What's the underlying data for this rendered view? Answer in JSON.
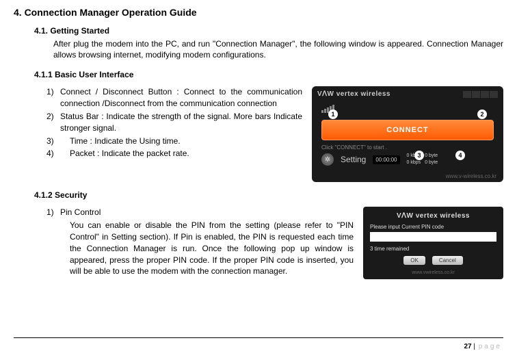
{
  "headings": {
    "h1": "4.    Connection Manager Operation Guide",
    "h2": "4.1.    Getting Started",
    "intro": "After plug the modem into the PC, and run \"Connection Manager\", the following window is appeared. Connection Manager allows browsing internet, modifying modem configurations.",
    "h3a": "4.1.1  Basic User Interface",
    "h3b": "4.1.2  Security"
  },
  "basic": {
    "item1_num": "1)",
    "item1": "Connect / Disconnect Button : Connect to the communication connection /Disconnect from the communication connection",
    "item2_num": "2)",
    "item2": "Status Bar : Indicate the strength of the signal. More bars Indicate stronger signal.",
    "item3_num": "3)",
    "item3": "Time : Indicate the Using time.",
    "item4_num": "4)",
    "item4": "Packet : Indicate the packet rate."
  },
  "security": {
    "item1_num": "1)",
    "item1_title": "Pin Control",
    "item1_body": "You can enable or disable the PIN from the setting (please refer to \"PIN Control\" in Setting section). If Pin is enabled, the PIN is requested each time the Connection Manager is run. Once the following pop up window is appeared, press the proper PIN code. If the proper PIN code is inserted, you will be able to use the modem with the connection manager."
  },
  "fig1": {
    "logo": "VᐱW vertex wireless",
    "connect": "CONNECT",
    "hint": "Click \"CONNECT\" to start .",
    "setting": "Setting",
    "timer": "00:00:00",
    "rate_up_k": "0 kbps",
    "rate_up_b": "0 byte",
    "rate_dn_k": "0 kbps",
    "rate_dn_b": "0 byte",
    "url": "www.v-wireless.co.kr",
    "b1": "1",
    "b2": "2",
    "b3": "3",
    "b4": "4"
  },
  "fig2": {
    "logo": "VᐱW vertex wireless",
    "label": "Please input Current PIN code",
    "remain": "3 time remained",
    "ok": "OK",
    "cancel": "Cancel",
    "url": "www.vwireless.co.kr"
  },
  "footer": {
    "page": "27",
    "sep": " | ",
    "word": "page"
  }
}
